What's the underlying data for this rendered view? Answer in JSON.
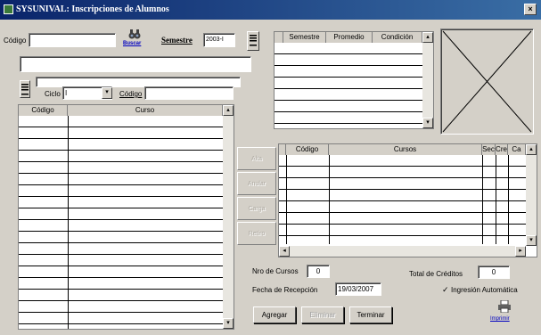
{
  "window": {
    "title": "SYSUNIVAL: Inscripciones de Alumnos",
    "close_glyph": "×"
  },
  "header": {
    "codigo_label": "Código",
    "codigo_value": "",
    "buscar_label": "Buscar",
    "semestre_label": "Semestre",
    "semestre_value": "2003-I",
    "nombre_value": "",
    "ciclo_label": "Ciclo",
    "ciclo_value": "I",
    "codigo2_label": "Código",
    "codigo2_value": ""
  },
  "historial": {
    "columns": [
      "Semestre",
      "Promedio",
      "Condición"
    ]
  },
  "cursos_disponibles": {
    "columns": [
      "Código",
      "Curso"
    ]
  },
  "cursos_inscritos": {
    "columns": [
      "Código",
      "Cursos",
      "Sec",
      "Cre",
      "Ca"
    ]
  },
  "side_buttons": [
    "Alta",
    "Anular",
    "Carga",
    "Retiro"
  ],
  "footer": {
    "nro_cursos_label": "Nro de Cursos",
    "nro_cursos_value": "0",
    "total_creditos_label": "Total de Créditos",
    "total_creditos_value": "0",
    "fecha_label": "Fecha de Recepción",
    "fecha_value": "19/03/2007",
    "ingresion_label": "Ingresión Automática",
    "ingresion_checked": true,
    "agregar_label": "Agregar",
    "eliminar_label": "Eliminar",
    "terminar_label": "Terminar",
    "imprimir_label": "Imprimir"
  },
  "colors": {
    "titlebar": "#0a246a",
    "face": "#d4d0c8",
    "link": "#0000c0"
  }
}
